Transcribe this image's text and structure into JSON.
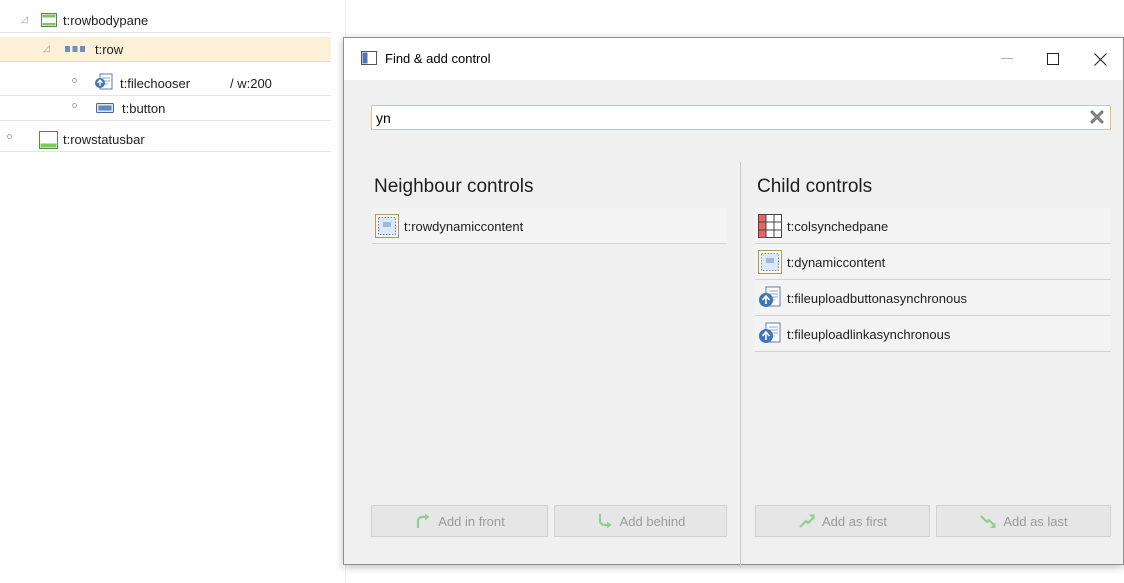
{
  "tree": {
    "nodes": [
      {
        "label": "t:rowbodypane",
        "extra": ""
      },
      {
        "label": "t:row",
        "extra": ""
      },
      {
        "label": "t:filechooser",
        "extra": "/ w:200"
      },
      {
        "label": "t:button",
        "extra": ""
      },
      {
        "label": "t:rowstatusbar",
        "extra": ""
      }
    ]
  },
  "dialog": {
    "title": "Find & add control",
    "search": {
      "value": "yn",
      "placeholder": ""
    },
    "neighbour": {
      "title": "Neighbour controls",
      "items": [
        {
          "label": "t:rowdynamiccontent",
          "icon": "dynamic-content-icon"
        }
      ],
      "buttons": {
        "add_in_front": "Add in front",
        "add_behind": "Add behind"
      }
    },
    "child": {
      "title": "Child controls",
      "items": [
        {
          "label": "t:colsynchedpane",
          "icon": "grid-pane-icon"
        },
        {
          "label": "t:dynamiccontent",
          "icon": "dynamic-content-icon"
        },
        {
          "label": "t:fileuploadbuttonasynchronous",
          "icon": "file-upload-icon"
        },
        {
          "label": "t:fileuploadlinkasynchronous",
          "icon": "file-upload-icon"
        }
      ],
      "buttons": {
        "add_as_first": "Add as first",
        "add_as_last": "Add as last"
      }
    }
  },
  "colors": {
    "selected_row": "#fcf1d8",
    "search_border": "#e5c27a",
    "disabled_button_text": "#9a9a9a",
    "accent_green": "#5aa85a"
  }
}
